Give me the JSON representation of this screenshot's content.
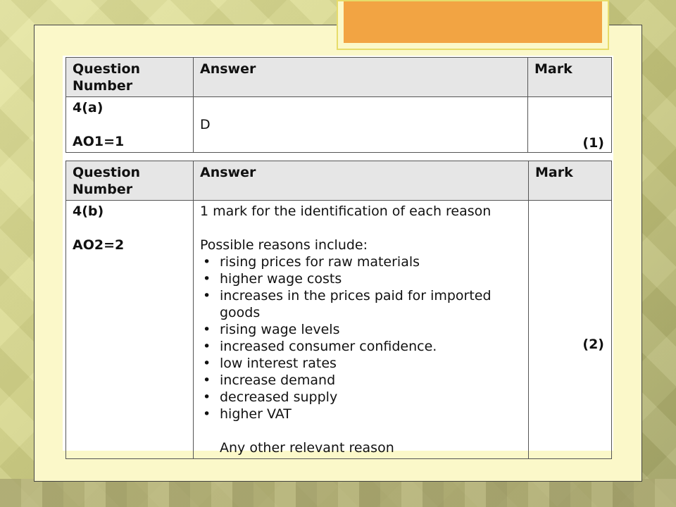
{
  "tables": [
    {
      "headers": [
        "Question Number",
        "Answer",
        "Mark"
      ],
      "question_number": "4(a)",
      "assessment_objective": "AO1=1",
      "answer": "D",
      "mark": "(1)"
    },
    {
      "headers": [
        "Question Number",
        "Answer",
        "Mark"
      ],
      "question_number": "4(b)",
      "assessment_objective": "AO2=2",
      "answer_intro": "1 mark for the identification of each reason",
      "reasons_heading": "Possible reasons include:",
      "reasons": [
        "rising prices for raw materials",
        "higher wage costs",
        "increases in the prices paid for imported goods",
        "rising wage levels",
        "increased consumer confidence.",
        "low interest rates",
        "increase demand",
        "decreased supply",
        "higher VAT"
      ],
      "closing": "Any other relevant reason",
      "mark": "(2)"
    }
  ],
  "colors": {
    "slide_background": "#d6d68a",
    "panel_background": "#fbf8c9",
    "title_accent": "#f2a443",
    "header_fill": "#e6e6e6"
  }
}
